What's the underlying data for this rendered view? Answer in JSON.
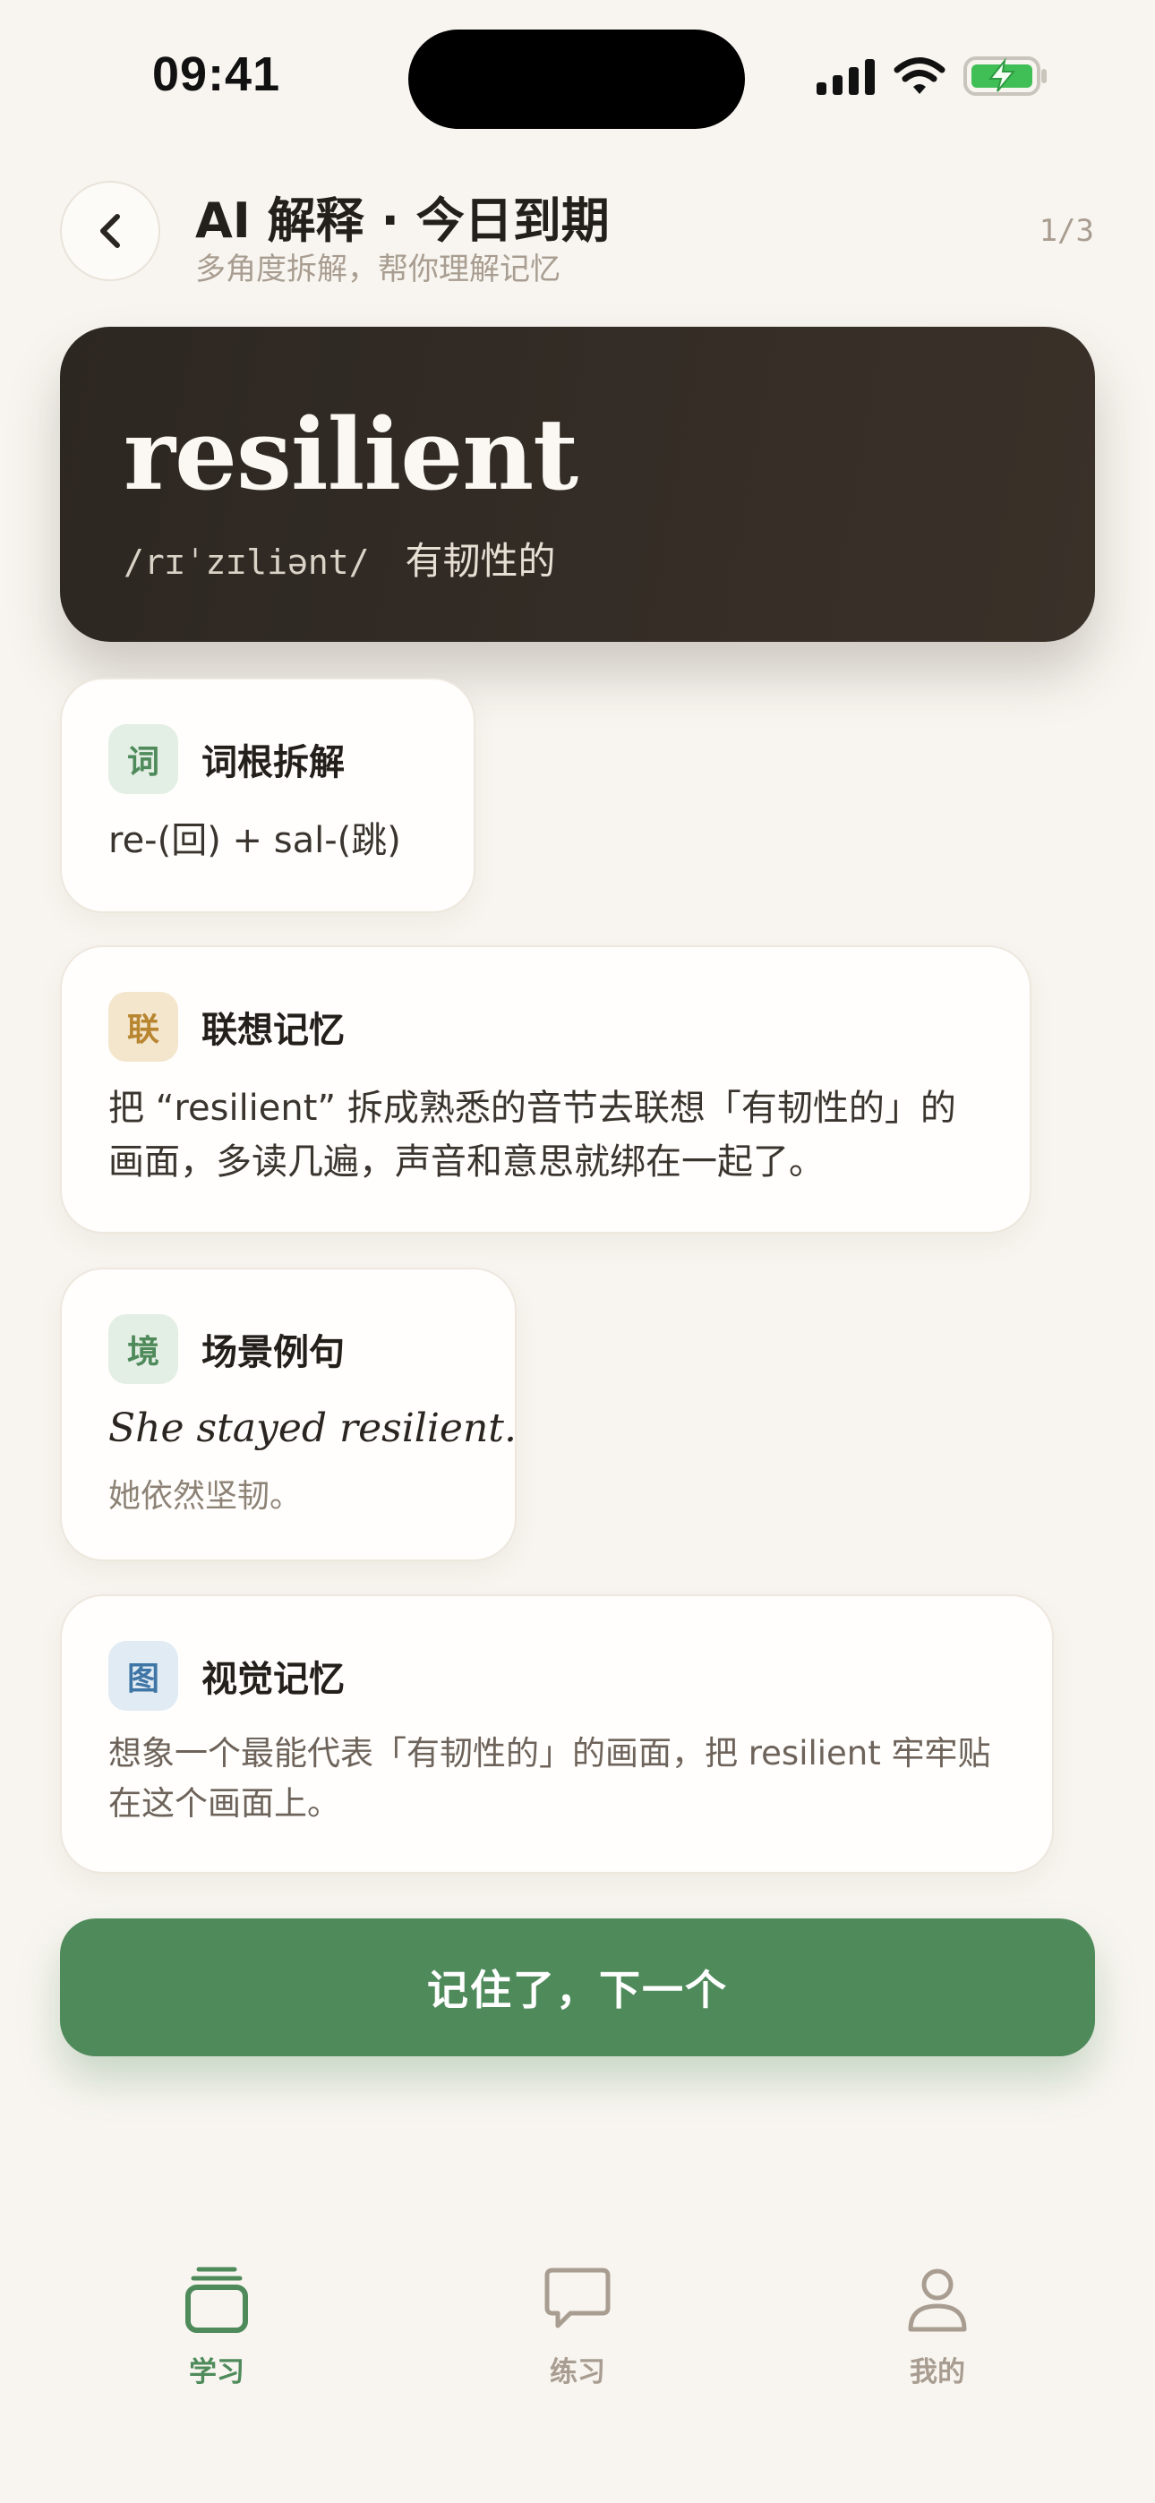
{
  "status_bar": {
    "time": "09:41"
  },
  "header": {
    "title": "AI 解释 · 今日到期",
    "subtitle": "多角度拆解，帮你理解记忆",
    "progress": "1/3"
  },
  "word_card": {
    "word": "resilient",
    "phonetic": "/rɪˈzɪliənt/",
    "meaning": "有韧性的"
  },
  "cards": {
    "root": {
      "tag": "词",
      "title": "词根拆解",
      "body": "re-(回) + sal-(跳)"
    },
    "association": {
      "tag": "联",
      "title": "联想记忆",
      "body": "把 “resilient” 拆成熟悉的音节去联想「有韧性的」的画面，多读几遍，声音和意思就绑在一起了。"
    },
    "scene": {
      "tag": "境",
      "title": "场景例句",
      "example_en": "She stayed resilient.",
      "example_cn": "她依然坚韧。"
    },
    "visual": {
      "tag": "图",
      "title": "视觉记忆",
      "body": "想象一个最能代表「有韧性的」的画面，把 resilient 牢牢贴在这个画面上。"
    }
  },
  "primary_button": {
    "label": "记住了，下一个"
  },
  "tab_bar": {
    "items": [
      {
        "label": "学习",
        "icon": "cards-stack-icon",
        "active": true
      },
      {
        "label": "练习",
        "icon": "chat-bubble-icon",
        "active": false
      },
      {
        "label": "我的",
        "icon": "person-icon",
        "active": false
      }
    ]
  },
  "colors": {
    "background": "#f8f5f0",
    "accent_green": "#4f8a5b",
    "word_card_dark": "#2d2722",
    "tag_amber": "#b88530",
    "tag_blue": "#3f76a6",
    "muted_text": "#a89d90"
  }
}
